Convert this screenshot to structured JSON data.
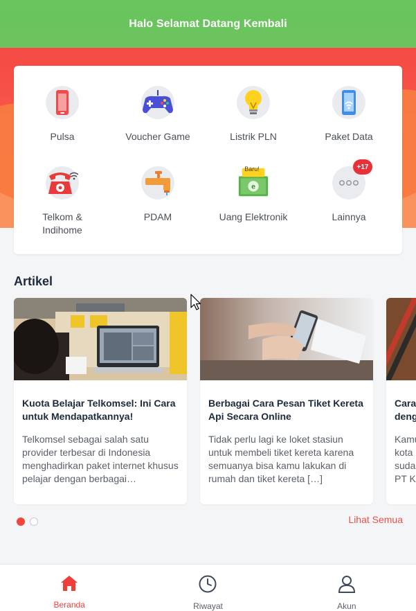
{
  "header": {
    "title": "Halo Selamat Datang Kembali"
  },
  "menu": {
    "items": [
      {
        "label": "Pulsa",
        "icon": "phone-icon"
      },
      {
        "label": "Voucher Game",
        "icon": "gamepad-icon"
      },
      {
        "label": "Listrik PLN",
        "icon": "lightbulb-icon"
      },
      {
        "label": "Paket Data",
        "icon": "data-phone-icon"
      },
      {
        "label": "Telkom &\nIndihome",
        "icon": "telephone-icon"
      },
      {
        "label": "PDAM",
        "icon": "water-tap-icon"
      },
      {
        "label": "Uang Elektronik",
        "icon": "e-money-icon",
        "tag": "Baru!"
      },
      {
        "label": "Lainnya",
        "icon": "more-icon",
        "badge": "+17"
      }
    ]
  },
  "articles": {
    "title": "Artikel",
    "cards": [
      {
        "title": "Kuota Belajar Telkomsel: Ini Cara untuk Mendapatkannya!",
        "desc": "Telkomsel sebagai salah satu provider terbesar di Indonesia menghadirkan paket internet khusus pelajar dengan berbagai…"
      },
      {
        "title": "Berbagai Cara Pesan Tiket Kereta Api Secara Online",
        "desc": "Tidak perlu lagi ke loket stasiun untuk membeli tiket kereta karena semuanya bisa kamu lakukan di rumah dan tiket kereta […]"
      },
      {
        "title": "Cara\ndeng",
        "desc": "Kamu\nkota\nsuda\nPT Ke"
      }
    ],
    "see_all": "Lihat Semua",
    "page_dots": 2,
    "active_dot": 1
  },
  "bottom_nav": [
    {
      "label": "Beranda",
      "icon": "home-icon",
      "active": true
    },
    {
      "label": "Riwayat",
      "icon": "clock-icon",
      "active": false
    },
    {
      "label": "Akun",
      "icon": "user-icon",
      "active": false
    }
  ],
  "colors": {
    "header_green": "#6cc35f",
    "hero_red": "#f03c3c",
    "accent": "#ef4f45"
  }
}
